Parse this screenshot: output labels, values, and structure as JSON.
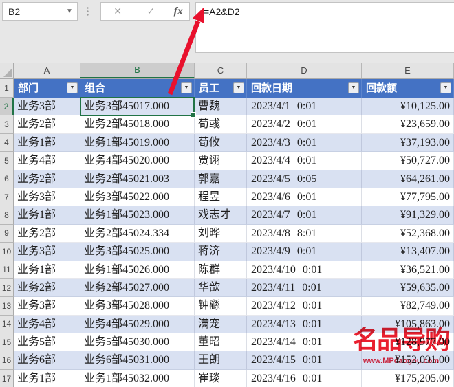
{
  "window": {
    "name_box_value": "B2",
    "formula_value": "=A2&D2"
  },
  "formula_bar": {
    "cancel_label": "✕",
    "enter_label": "✓",
    "fx_label": "fx"
  },
  "icons": {
    "namebox_dropdown": "▼",
    "filter_dropdown": "▼"
  },
  "sheet": {
    "selected_cell": "B2",
    "selected_column": "B",
    "selected_row": "2",
    "column_letters": [
      "A",
      "B",
      "C",
      "D",
      "E"
    ],
    "row_numbers": [
      "1",
      "2",
      "3",
      "4",
      "5",
      "6",
      "7",
      "8",
      "9",
      "10",
      "11",
      "12",
      "13",
      "14",
      "15",
      "16",
      "17"
    ],
    "table": {
      "headers": [
        "部门",
        "组合",
        "员工",
        "回款日期",
        "回款额"
      ],
      "rows": [
        [
          "业务3部",
          "业务3部45017.000",
          "曹魏",
          "2023/4/1 0:01",
          "¥10,125.00"
        ],
        [
          "业务2部",
          "业务2部45018.000",
          "荀彧",
          "2023/4/2 0:01",
          "¥23,659.00"
        ],
        [
          "业务1部",
          "业务1部45019.000",
          "荀攸",
          "2023/4/3 0:01",
          "¥37,193.00"
        ],
        [
          "业务4部",
          "业务4部45020.000",
          "贾诩",
          "2023/4/4 0:01",
          "¥50,727.00"
        ],
        [
          "业务2部",
          "业务2部45021.003",
          "郭嘉",
          "2023/4/5 0:05",
          "¥64,261.00"
        ],
        [
          "业务3部",
          "业务3部45022.000",
          "程昱",
          "2023/4/6 0:01",
          "¥77,795.00"
        ],
        [
          "业务1部",
          "业务1部45023.000",
          "戏志才",
          "2023/4/7 0:01",
          "¥91,329.00"
        ],
        [
          "业务2部",
          "业务2部45024.334",
          "刘晔",
          "2023/4/8 8:01",
          "¥52,368.00"
        ],
        [
          "业务3部",
          "业务3部45025.000",
          "蒋济",
          "2023/4/9 0:01",
          "¥13,407.00"
        ],
        [
          "业务1部",
          "业务1部45026.000",
          "陈群",
          "2023/4/10 0:01",
          "¥36,521.00"
        ],
        [
          "业务2部",
          "业务2部45027.000",
          "华歆",
          "2023/4/11 0:01",
          "¥59,635.00"
        ],
        [
          "业务3部",
          "业务3部45028.000",
          "钟繇",
          "2023/4/12 0:01",
          "¥82,749.00"
        ],
        [
          "业务4部",
          "业务4部45029.000",
          "满宠",
          "2023/4/13 0:01",
          "¥105,863.00"
        ],
        [
          "业务5部",
          "业务5部45030.000",
          "董昭",
          "2023/4/14 0:01",
          "¥128,977.00"
        ],
        [
          "业务6部",
          "业务6部45031.000",
          "王朗",
          "2023/4/15 0:01",
          "¥152,091.00"
        ],
        [
          "业务1部",
          "业务1部45032.000",
          "崔琰",
          "2023/4/16 0:01",
          "¥175,205.00"
        ]
      ]
    }
  },
  "annotation": {
    "arrow_color": "#e8112d"
  },
  "watermark": {
    "logo_text": "名品导购",
    "url_text": "www.MPdaogou.com",
    "color": "#e60012"
  },
  "colors": {
    "header_fill": "#4472c4",
    "band_fill": "#d9e1f2",
    "selection_green": "#217346",
    "chrome_gray": "#e7e7e7"
  }
}
